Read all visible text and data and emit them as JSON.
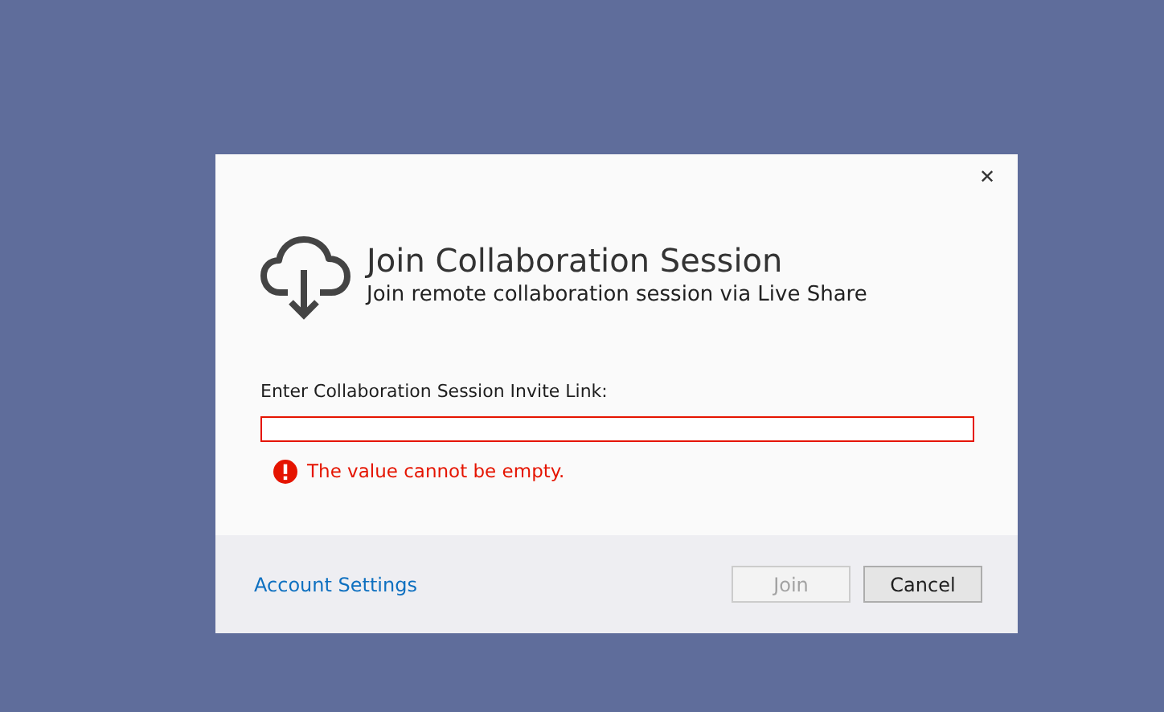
{
  "dialog": {
    "close_glyph": "✕",
    "title": "Join Collaboration Session",
    "subtitle": "Join remote collaboration session via Live Share",
    "field": {
      "label": "Enter Collaboration Session Invite Link:",
      "invalid": true,
      "error": "The value cannot be empty."
    },
    "footer": {
      "link": "Account Settings",
      "buttons": [
        {
          "label": "Join",
          "disabled": true
        },
        {
          "label": "Cancel",
          "disabled": false
        }
      ]
    }
  }
}
